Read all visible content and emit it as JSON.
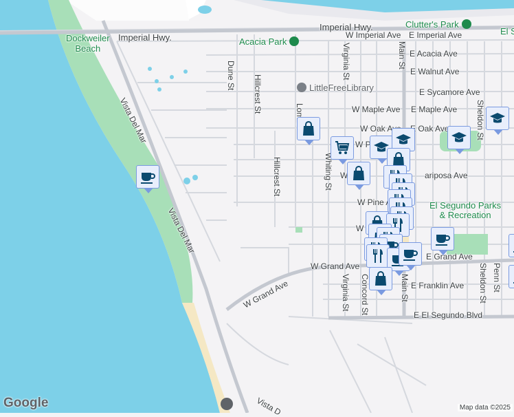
{
  "labels": {
    "imperial_hwy": "Imperial Hwy.",
    "imperial_hwy_east": "Imperial Hwy.",
    "dockweiler": "Dockweiler\nBeach",
    "acacia_park": "Acacia Park",
    "clutters_park": "Clutter's Park",
    "el_s": "El S",
    "w_imperial": "W Imperial Ave",
    "e_imperial": "E Imperial Ave",
    "e_acacia": "E Acacia Ave",
    "e_walnut": "E Walnut Ave",
    "library": "LittleFreeLibrary",
    "e_sycamore": "E Sycamore Ave",
    "w_maple": "W Maple Ave",
    "e_maple": "E Maple Ave",
    "w_oak": "W Oak Ave",
    "e_oak": "E Oak Ave",
    "dune": "Dune St",
    "hillcrest1": "Hillcrest St",
    "hillcrest2": "Hillcrest St",
    "lomita": "Lom St",
    "virginia1": "Virginia St",
    "virginia2": "Virginia St",
    "main1": "Main St",
    "main2": "Main St",
    "sheldon1": "Sheldon St",
    "sheldon2": "Sheldon St",
    "vista1": "Vista Del Mar",
    "vista2": "Vista Del Mar",
    "vista3": "Vista D",
    "whiting": "Whiting St",
    "w_mariposa": "W      sa",
    "e_mariposa": "ariposa Ave",
    "w_pine": "W Pine A",
    "parks": "El Segundo Parks\n& Recreation",
    "w_grand1": "W Grand Ave",
    "w_grand2": "W Grand Ave",
    "e_grand": "E Grand Ave",
    "concord": "Concord St",
    "e_franklin": "E Franklin Ave",
    "penn": "Penn St",
    "e_el_segundo": "E El Segundo Blvd",
    "w_p": "W P",
    "w_x": "W"
  },
  "footer": {
    "logo": "Google",
    "attribution": "Map data ©2025"
  },
  "colors": {
    "water": "#7dd0e8",
    "park": "#a8dfb8",
    "beach": "#f5e8c4",
    "marker_bg": "#e8eefc",
    "marker_border": "#7a9ae0",
    "icon": "#0b4a6f"
  }
}
